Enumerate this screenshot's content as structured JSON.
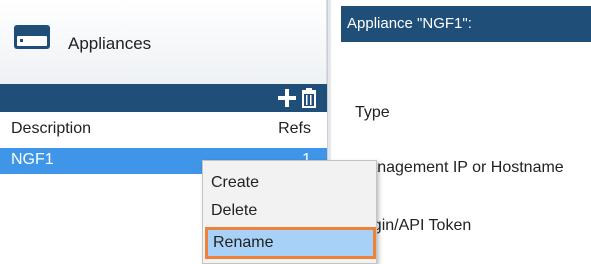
{
  "left_panel": {
    "title": "Appliances",
    "icon": "appliance-box-icon",
    "toolbar": {
      "add_icon": "plus-icon",
      "delete_icon": "trash-icon"
    },
    "columns": {
      "description": "Description",
      "refs": "Refs"
    },
    "rows": [
      {
        "description": "NGF1",
        "refs": "1",
        "selected": true
      }
    ]
  },
  "right_panel": {
    "header": "Appliance \"NGF1\":",
    "fields": {
      "type": "Type",
      "management": "Management IP or Hostname",
      "login": "Login/API Token"
    }
  },
  "context_menu": {
    "items": [
      "Create",
      "Delete",
      "Rename"
    ],
    "highlighted": "Rename"
  },
  "colors": {
    "header_blue": "#1f4e79",
    "selection_blue": "#3f95e8",
    "menu_highlight": "#a8d1f7",
    "focus_orange": "#f0813a"
  }
}
